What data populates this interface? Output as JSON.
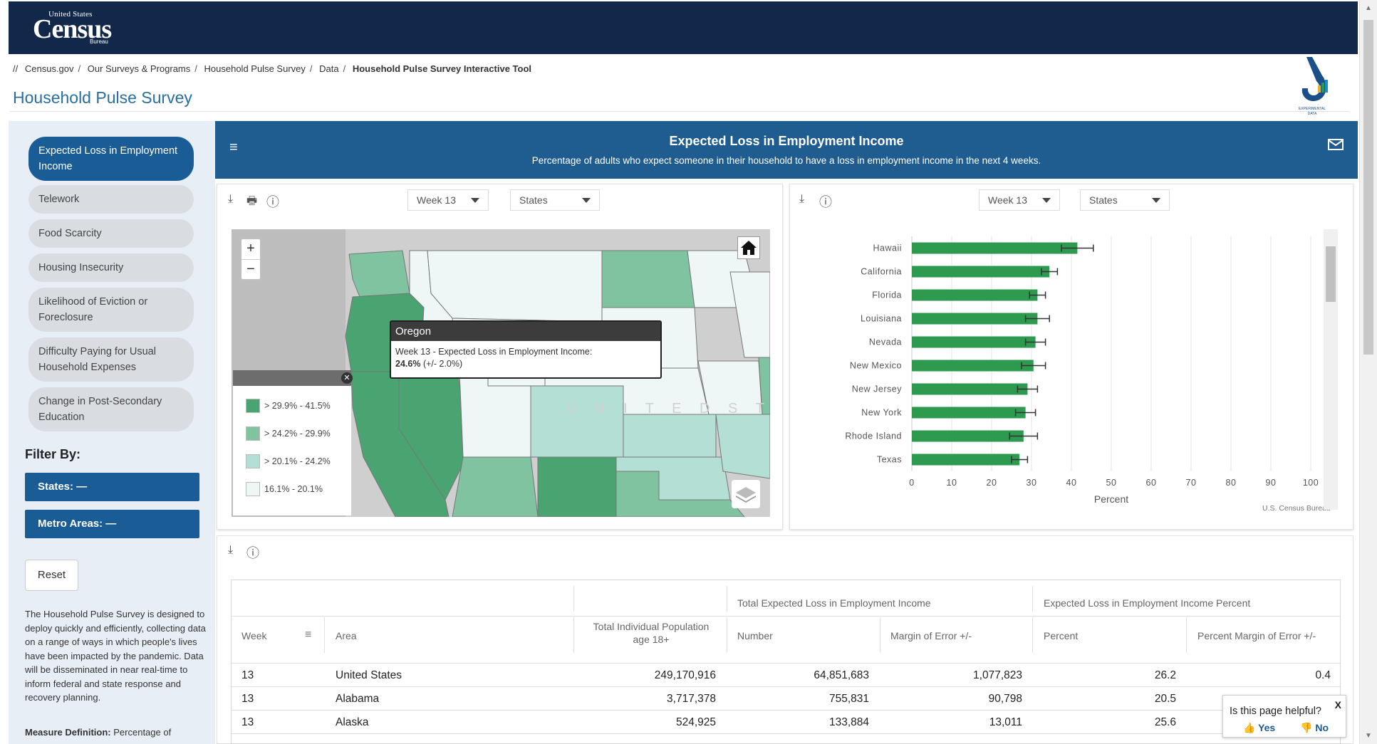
{
  "header": {
    "logo_small": "United States",
    "logo_big": "Census",
    "logo_bureau": "Bureau"
  },
  "breadcrumb": [
    "//",
    "Census.gov",
    "Our Surveys & Programs",
    "Household Pulse Survey",
    "Data",
    "Household Pulse Survey Interactive Tool"
  ],
  "page_title": "Household Pulse Survey",
  "experimental_logo_text": "EXPERIMENTAL DATA",
  "sidebar": {
    "topics": [
      "Expected Loss in Employment Income",
      "Telework",
      "Food Scarcity",
      "Housing Insecurity",
      "Likelihood of Eviction or Foreclosure",
      "Difficulty Paying for Usual Household Expenses",
      "Change in Post-Secondary Education"
    ],
    "filter_label": "Filter By:",
    "filter_states": "States: —",
    "filter_metro": "Metro Areas: —",
    "reset": "Reset",
    "about": "The Household Pulse Survey is designed to deploy quickly and efficiently, collecting data on a range of ways in which people's lives have been impacted by the pandemic. Data will be disseminated in near real-time to inform federal and state response and recovery planning.",
    "measure_label": "Measure Definition:",
    "measure_text": "Percentage of"
  },
  "banner": {
    "title": "Expected Loss in Employment Income",
    "subtitle": "Percentage of adults who expect someone in their household to have a loss in employment income in the next 4 weeks.",
    "menu_icon": "collapse-menu-icon",
    "mail_icon": "mail-icon"
  },
  "map_panel": {
    "week_select": "Week 13",
    "geo_select": "States",
    "map_label": "U N I T E D   S T A T E S",
    "tooltip": {
      "state": "Oregon",
      "line": "Week 13 - Expected Loss in Employment Income:",
      "value": "24.6%",
      "moe": "(+/- 2.0%)"
    },
    "legend": [
      {
        "label": "> 29.9% - 41.5%",
        "color": "#4aa472"
      },
      {
        "label": "> 24.2% - 29.9%",
        "color": "#7fc3a0"
      },
      {
        "label": "> 20.1% - 24.2%",
        "color": "#b4dfd5"
      },
      {
        "label": "16.1% - 20.1%",
        "color": "#eef6f6"
      }
    ]
  },
  "chart_panel": {
    "week_select": "Week 13",
    "geo_select": "States",
    "credit": "U.S. Census Bureau"
  },
  "chart_data": {
    "type": "bar",
    "orientation": "horizontal",
    "categories": [
      "Hawaii",
      "California",
      "Florida",
      "Louisiana",
      "Nevada",
      "New Mexico",
      "New Jersey",
      "New York",
      "Rhode Island",
      "Texas"
    ],
    "values": [
      41.5,
      34.5,
      31.5,
      31.5,
      31.0,
      30.5,
      29.0,
      28.5,
      28.0,
      27.0
    ],
    "error": [
      4.0,
      2.0,
      2.0,
      3.0,
      2.5,
      3.0,
      2.5,
      2.5,
      3.5,
      2.0
    ],
    "xlabel": "Percent",
    "xlim": [
      0,
      100
    ],
    "xticks": [
      0,
      10,
      20,
      30,
      40,
      50,
      60,
      70,
      80,
      90,
      100
    ],
    "bar_color": "#2e9a4f",
    "grid": true
  },
  "table": {
    "group_headers": {
      "total": "Total Expected Loss in Employment Income",
      "percent": "Expected Loss in Employment Income Percent"
    },
    "headers": {
      "week": "Week",
      "area": "Area",
      "population": "Total Individual Population age 18+",
      "number": "Number",
      "moe": "Margin of Error +/-",
      "percent": "Percent",
      "percent_moe": "Percent Margin of Error +/-"
    },
    "rows": [
      {
        "week": "13",
        "area": "United States",
        "population": "249,170,916",
        "number": "64,851,683",
        "moe": "1,077,823",
        "percent": "26.2",
        "percent_moe": "0.4"
      },
      {
        "week": "13",
        "area": "Alabama",
        "population": "3,717,378",
        "number": "755,831",
        "moe": "90,798",
        "percent": "20.5",
        "percent_moe": ""
      },
      {
        "week": "13",
        "area": "Alaska",
        "population": "524,925",
        "number": "133,884",
        "moe": "13,011",
        "percent": "25.6",
        "percent_moe": ""
      }
    ]
  },
  "feedback": {
    "question": "Is this page helpful?",
    "yes": "Yes",
    "no": "No",
    "close": "X"
  }
}
